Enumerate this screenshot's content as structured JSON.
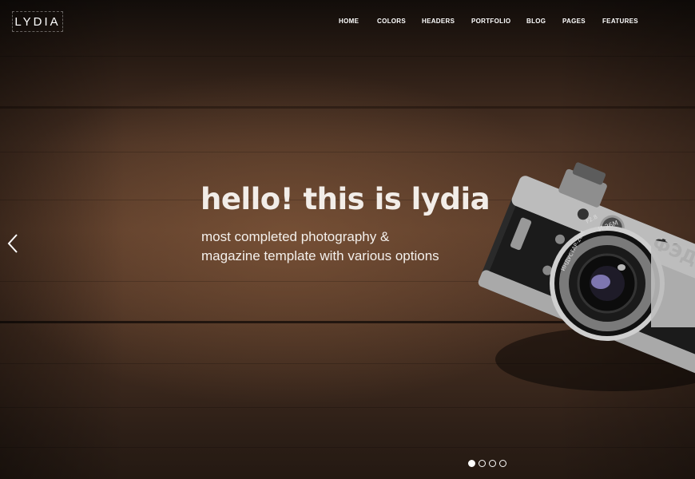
{
  "brand": {
    "logo_text": "LYDIA"
  },
  "nav": {
    "items": [
      "HOME",
      "COLORS",
      "HEADERS",
      "PORTFOLIO",
      "BLOG",
      "PAGES",
      "FEATURES"
    ]
  },
  "hero": {
    "headline": "hello! this is lydia",
    "subline_1": "most completed photography &",
    "subline_2": "magazine template with various options",
    "camera": {
      "body_text": "ФЭД",
      "lens_text_1": "И-26М",
      "lens_text_2": "ИНДУСТАР-26М",
      "lens_text_3": "F2.8"
    }
  },
  "slider": {
    "slide_count": 4,
    "active_index": 0
  },
  "colors": {
    "text": "#ffffff",
    "wood_dark": "#241912",
    "wood_mid": "#5a3c2a"
  }
}
